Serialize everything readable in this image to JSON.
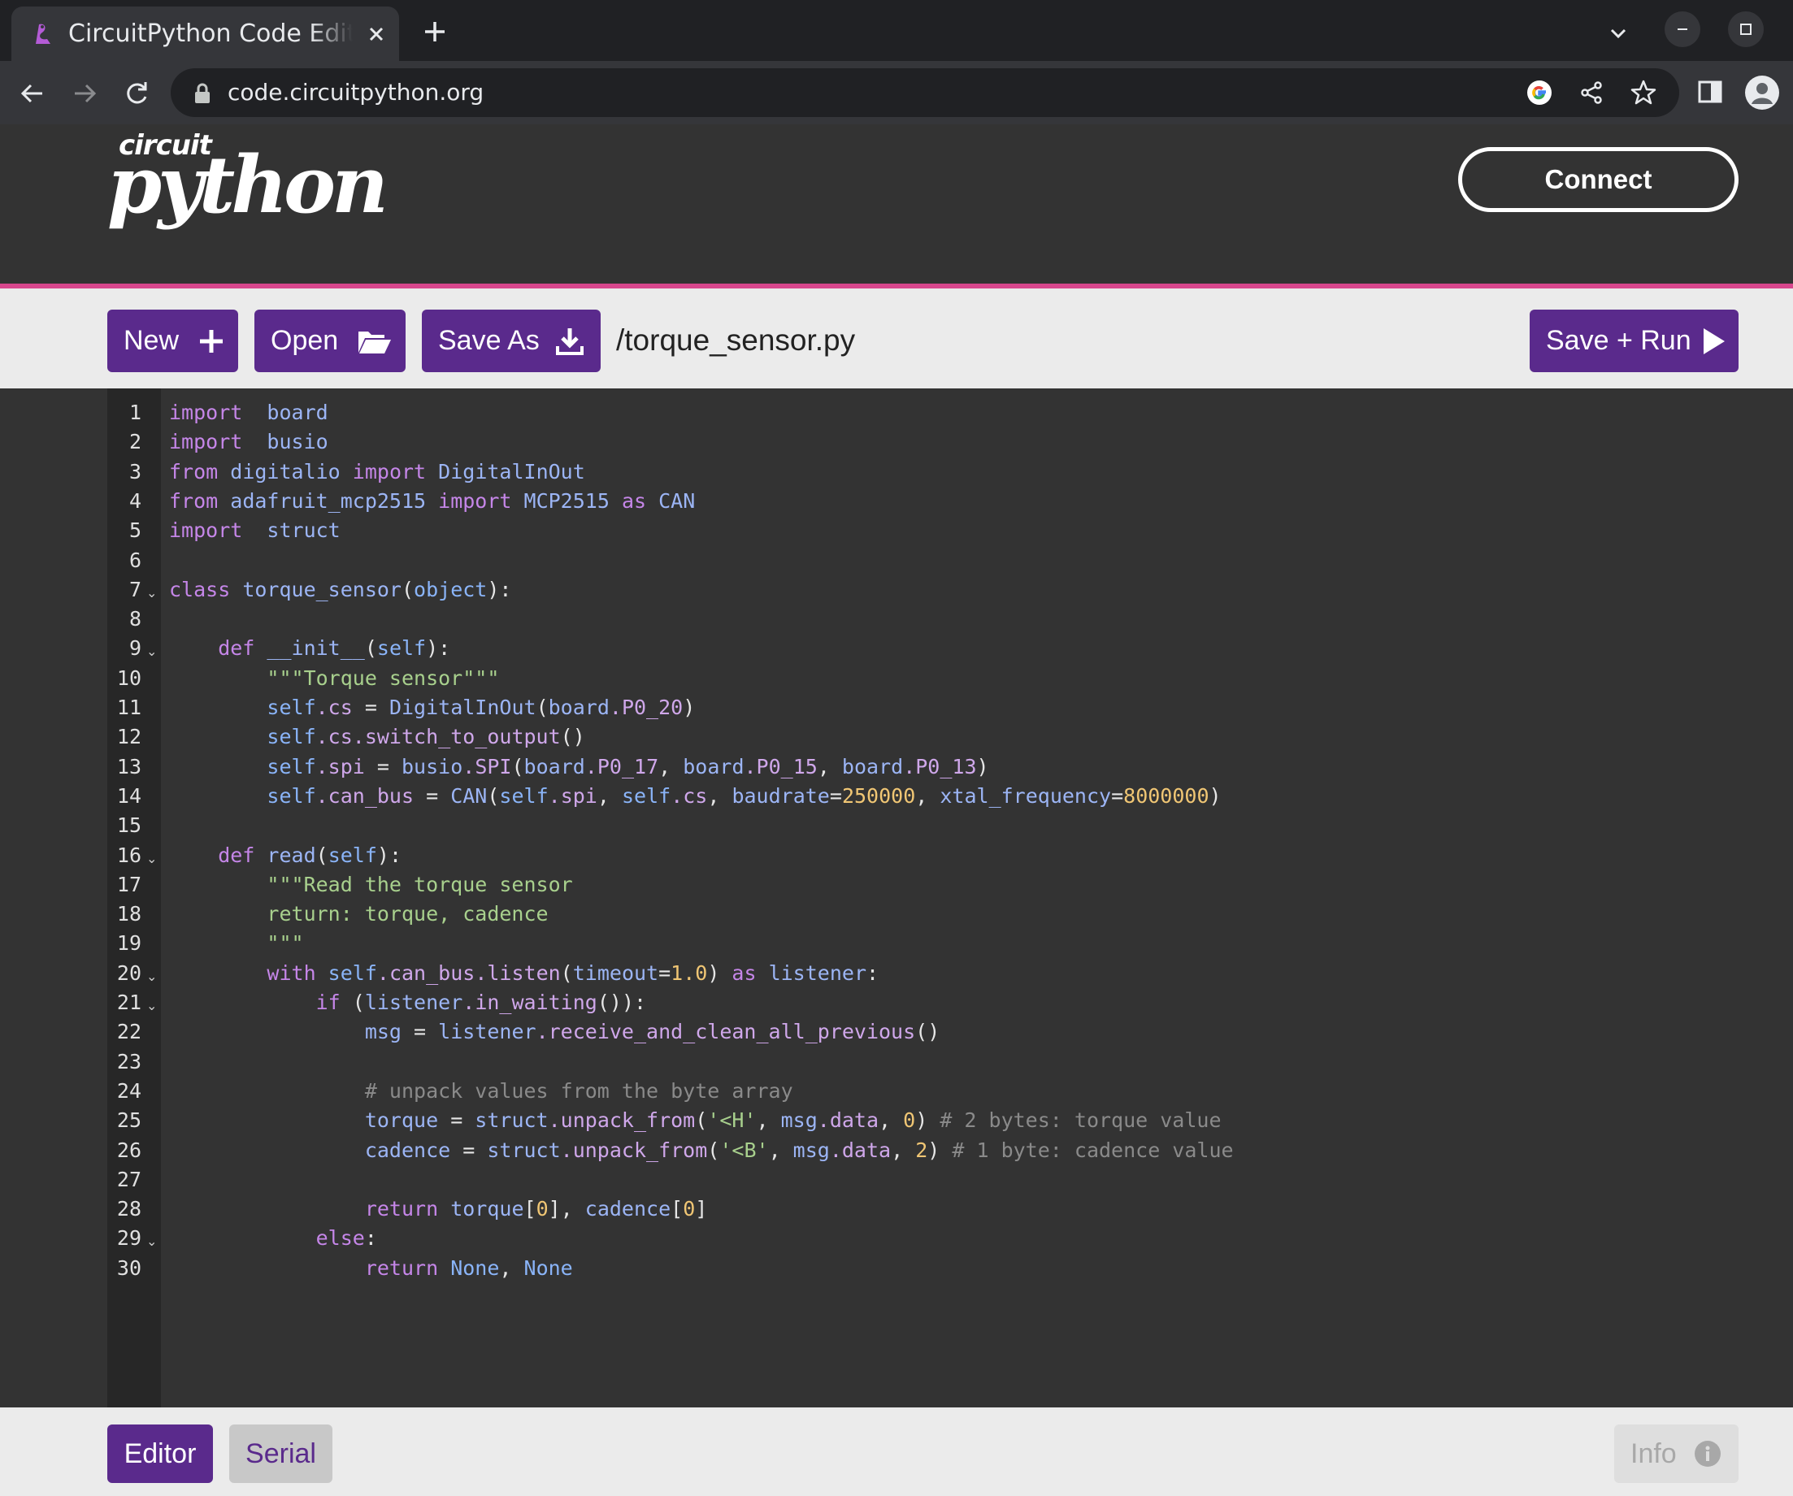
{
  "browser": {
    "tab_title": "CircuitPython Code Editor",
    "url": "code.circuitpython.org"
  },
  "header": {
    "logo_small": "circuit",
    "logo_big": "python",
    "connect_label": "Connect"
  },
  "file_bar": {
    "new_label": "New",
    "open_label": "Open",
    "save_as_label": "Save As",
    "filename": "/torque_sensor.py",
    "save_run_label": "Save + Run"
  },
  "editor": {
    "line_numbers": [
      "1",
      "2",
      "3",
      "4",
      "5",
      "6",
      "7",
      "8",
      "9",
      "10",
      "11",
      "12",
      "13",
      "14",
      "15",
      "16",
      "17",
      "18",
      "19",
      "20",
      "21",
      "22",
      "23",
      "24",
      "25",
      "26",
      "27",
      "28",
      "29",
      "30"
    ],
    "fold_marker": "⌄",
    "code_tokens": [
      [
        "import ",
        " board"
      ],
      [
        "import ",
        " busio"
      ],
      [
        "from",
        " digitalio ",
        "import",
        " DigitalInOut"
      ],
      [
        "from",
        " adafruit_mcp2515 ",
        "import",
        " MCP2515 ",
        "as",
        " CAN"
      ],
      [
        "import ",
        " struct"
      ],
      [],
      [
        "class",
        " torque_sensor",
        "(",
        "object",
        "):"
      ],
      [],
      [
        "    def ",
        "__init__",
        "(",
        "self",
        "):"
      ],
      [
        "        \"\"\"Torque sensor\"\"\""
      ],
      [
        "        self",
        ".cs",
        " = ",
        "DigitalInOut",
        "(",
        "board",
        ".P0_20",
        ")"
      ],
      [
        "        self",
        ".cs",
        ".switch_to_output",
        "()"
      ],
      [
        "        self",
        ".spi",
        " = ",
        "busio",
        ".SPI",
        "(",
        "board",
        ".P0_17",
        ", ",
        "board",
        ".P0_15",
        ", ",
        "board",
        ".P0_13",
        ")"
      ],
      [
        "        self",
        ".can_bus",
        " = ",
        "CAN",
        "(",
        "self",
        ".spi",
        ", ",
        "self",
        ".cs",
        ", ",
        "baudrate",
        "=",
        "250000",
        ", ",
        "xtal_frequency",
        "=",
        "8000000",
        ")"
      ],
      [],
      [
        "    def ",
        "read",
        "(",
        "self",
        "):"
      ],
      [
        "        \"\"\"Read the torque sensor"
      ],
      [
        "        return: torque, cadence"
      ],
      [
        "        \"\"\""
      ],
      [
        "        with ",
        "self",
        ".can_bus",
        ".listen",
        "(",
        "timeout",
        "=",
        "1.0",
        ") ",
        "as",
        " listener",
        ":"
      ],
      [
        "            if ",
        "(",
        "listener",
        ".in_waiting",
        "()):"
      ],
      [
        "                msg",
        " = ",
        "listener",
        ".receive_and_clean_all_previous",
        "()"
      ],
      [],
      [
        "                # unpack values from the byte array"
      ],
      [
        "                torque",
        " = ",
        "struct",
        ".unpack_from",
        "(",
        "'<H'",
        ", ",
        "msg",
        ".data",
        ", ",
        "0",
        ") ",
        "# 2 bytes: torque value"
      ],
      [
        "                cadence",
        " = ",
        "struct",
        ".unpack_from",
        "(",
        "'<B'",
        ", ",
        "msg",
        ".data",
        ", ",
        "2",
        ") ",
        "# 1 byte: cadence value"
      ],
      [],
      [
        "                return ",
        "torque",
        "[",
        "0",
        "], ",
        "cadence",
        "[",
        "0",
        "]"
      ],
      [
        "            else",
        ":"
      ],
      [
        "                return ",
        "None",
        ", ",
        "None"
      ]
    ]
  },
  "footer": {
    "editor_tab": "Editor",
    "serial_tab": "Serial",
    "info_label": "Info"
  },
  "colors": {
    "accent_purple": "#5a2a8c",
    "header_stripe": "#d8478d"
  }
}
